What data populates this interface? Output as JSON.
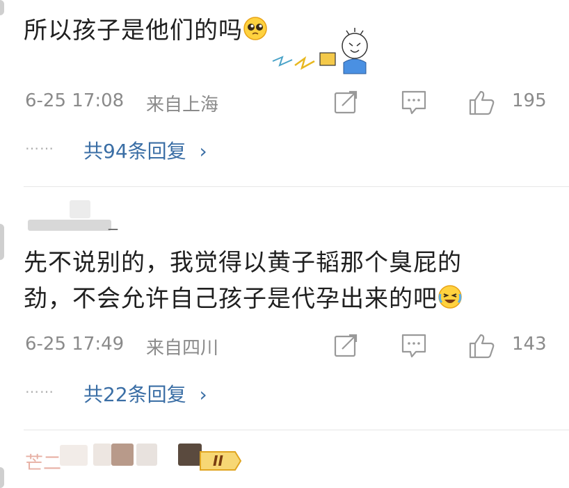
{
  "comments": [
    {
      "text": "所以孩子是他们的吗",
      "emoji": "pleading-face-icon",
      "time": "6-25 17:08",
      "location": "来自上海",
      "likes": "195",
      "replies_label": "共94条回复",
      "dots": "……",
      "chevron": "›"
    },
    {
      "username_hint": "_",
      "text_line1": "先不说别的，我觉得以黄子韬那个臭屁的",
      "text_line2": "劲，不会允许自己孩子是代孕出来的吧",
      "emoji": "laughing-crying-face-icon",
      "time": "6-25 17:49",
      "location": "来自四川",
      "likes": "143",
      "replies_label": "共22条回复",
      "dots": "……",
      "chevron": "›"
    }
  ],
  "third_user": {
    "badge": "II",
    "name_hint": "芒二"
  },
  "colors": {
    "text": "#1f1f1f",
    "meta": "#8a8a8a",
    "link": "#3a6ea5",
    "divider": "#e6e6e6",
    "badge": "#f2c230"
  }
}
